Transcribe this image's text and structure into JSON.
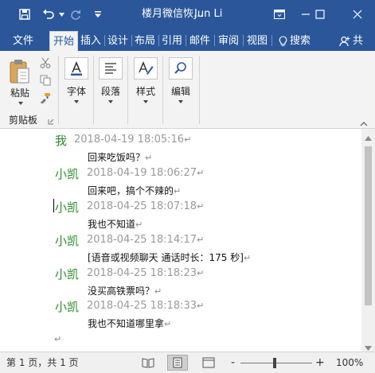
{
  "titlebar": {
    "title": "楼月微信恢...",
    "user": "Jun Li",
    "icons": [
      "save-icon",
      "undo-icon",
      "redo-icon",
      "customize-quick-access-icon",
      "ribbon-display-options-icon",
      "minimize-icon",
      "maximize-icon",
      "close-icon"
    ]
  },
  "tabs": [
    {
      "label": "文件",
      "active": false
    },
    {
      "label": "开始",
      "active": true
    },
    {
      "label": "插入",
      "active": false
    },
    {
      "label": "设计",
      "active": false
    },
    {
      "label": "布局",
      "active": false
    },
    {
      "label": "引用",
      "active": false
    },
    {
      "label": "邮件",
      "active": false
    },
    {
      "label": "审阅",
      "active": false
    },
    {
      "label": "视图",
      "active": false
    }
  ],
  "search": {
    "label": "搜索"
  },
  "share": {
    "label": "共"
  },
  "ribbon": {
    "paste": "粘贴",
    "clipboard": "剪贴板",
    "font": "字体",
    "paragraph": "段落",
    "styles": "样式",
    "editing": "编辑"
  },
  "messages": [
    {
      "name": "我",
      "time": "2018-04-19 18:05:16",
      "text": "回来吃饭吗？"
    },
    {
      "name": "小凯",
      "time": "2018-04-19 18:06:27",
      "text": "回来吧，搞个不辣的"
    },
    {
      "name": "小凯",
      "time": "2018-04-25 18:07:18",
      "text": "我也不知道"
    },
    {
      "name": "小凯",
      "time": "2018-04-25 18:14:17",
      "text": "[语音或视频聊天 通话时长：175 秒]"
    },
    {
      "name": "小凯",
      "time": "2018-04-25 18:18:23",
      "text": "没买高铁票吗？"
    },
    {
      "name": "小凯",
      "time": "2018-04-25 18:18:33",
      "text": "我也不知道哪里拿"
    }
  ],
  "para_mark": "↵",
  "statusbar": {
    "page": "第 1 页，共 1 页",
    "zoom": "100%",
    "zoom_minus": "-",
    "zoom_plus": "+"
  }
}
